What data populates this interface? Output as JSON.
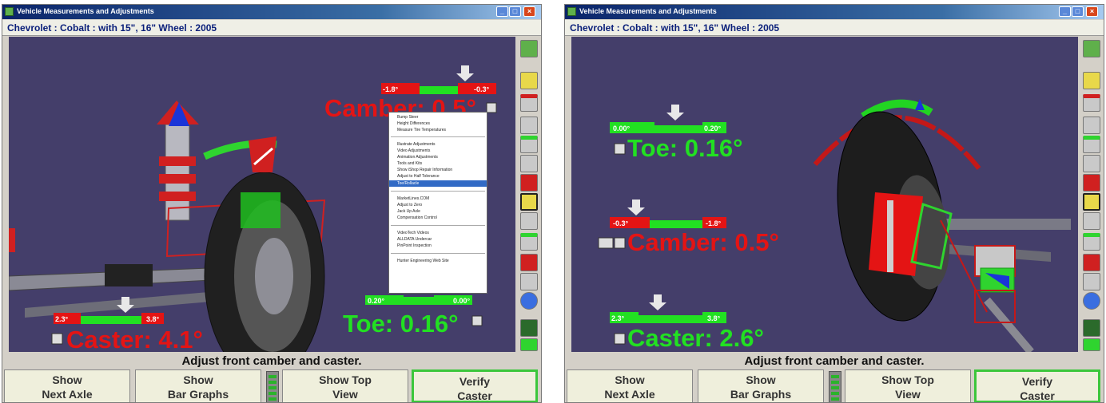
{
  "window": {
    "title": "Vehicle Measurements and Adjustments",
    "vehicle": "Chevrolet : Cobalt : with 15\", 16\" Wheel : 2005",
    "minimize_glyph": "_",
    "maximize_glyph": "□",
    "close_glyph": "×"
  },
  "instruction": "Adjust front camber and caster.",
  "buttons": {
    "next_axle": [
      "Show",
      "Next Axle"
    ],
    "bar_graphs": [
      "Show",
      "Bar Graphs"
    ],
    "top_view": [
      "Show Top",
      "View"
    ],
    "verify": [
      "Verify",
      "Caster"
    ]
  },
  "screen1": {
    "camber": {
      "label": "Camber: 0.5°",
      "left": "-1.8°",
      "right": "-0.3°"
    },
    "toe": {
      "label": "Toe: 0.16°",
      "left": "0.20°",
      "right": "0.00°"
    },
    "caster": {
      "label": "Caster: 4.1°",
      "left": "2.3°",
      "right": "3.8°"
    },
    "menu": [
      "Bump Steer",
      "Height Differences",
      "Measure Tire Temperatures",
      "Illustrate Adjustments",
      "Video Adjustments",
      "Animation Adjustments",
      "Tools and Kits",
      "Show iShop Repair Information",
      "Adjust to Half Tolerance",
      "Toe/Rollacle",
      "MarketLines.COM",
      "Adjust to Zero",
      "Jack Up Axle",
      "Compensation Control",
      "VideoTech Videos",
      "ALLDATA Undercar",
      "PinPoint Inspection",
      "Hunter Engineering Web Site"
    ]
  },
  "screen2": {
    "toe": {
      "label": "Toe: 0.16°",
      "left": "0.00°",
      "right": "0.20°"
    },
    "camber": {
      "label": "Camber: 0.5°",
      "left": "-0.3°",
      "right": "-1.8°"
    },
    "caster": {
      "label": "Caster: 2.6°",
      "left": "2.3°",
      "right": "3.8°"
    }
  },
  "colors": {
    "in_spec": "#22e022",
    "out_of_spec": "#e41414",
    "viewport_bg": "#443e6a",
    "verify_border": "#3cc63c"
  }
}
